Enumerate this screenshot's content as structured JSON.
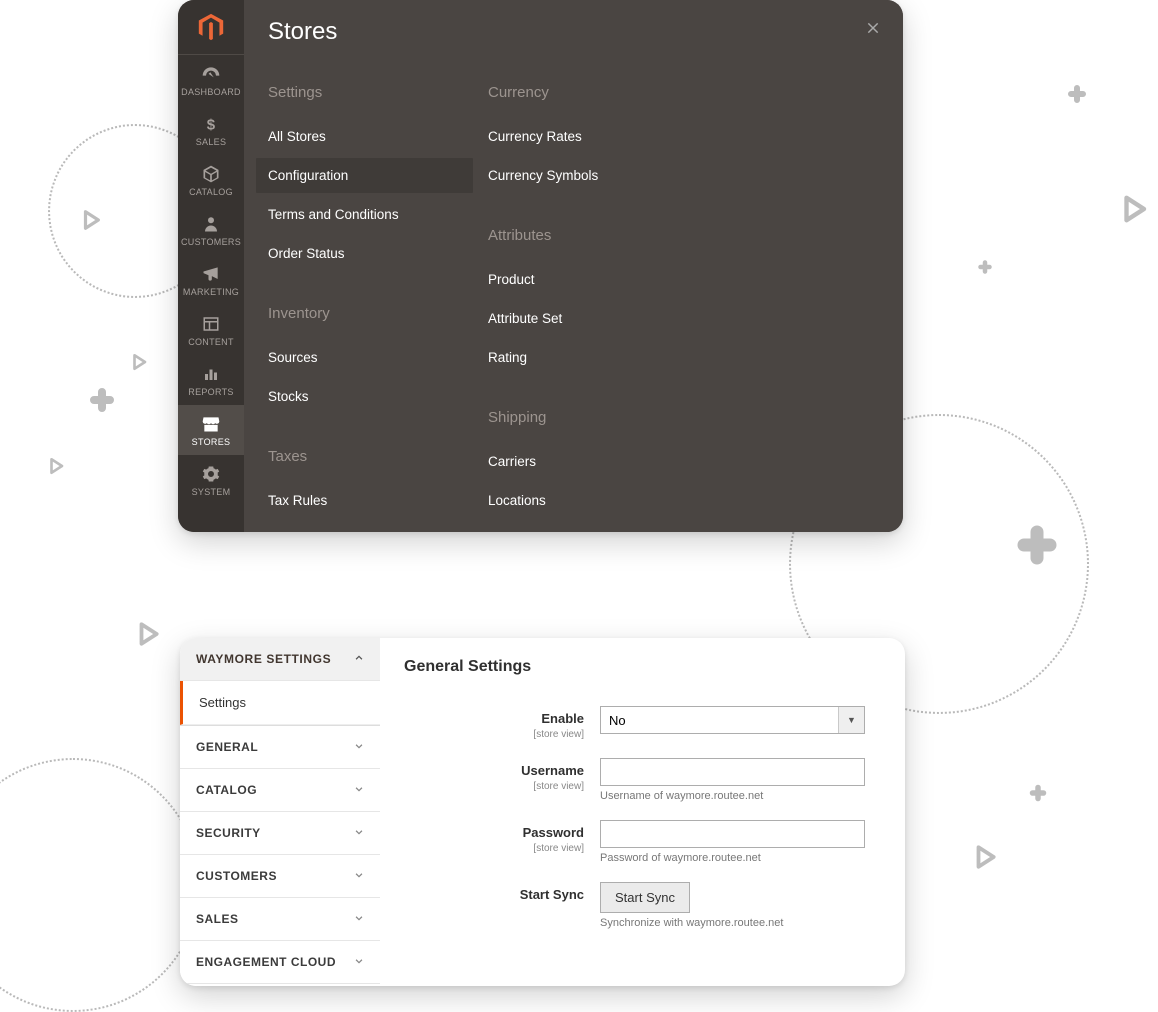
{
  "nav": {
    "items": [
      {
        "label": "DASHBOARD"
      },
      {
        "label": "SALES"
      },
      {
        "label": "CATALOG"
      },
      {
        "label": "CUSTOMERS"
      },
      {
        "label": "MARKETING"
      },
      {
        "label": "CONTENT"
      },
      {
        "label": "REPORTS"
      },
      {
        "label": "STORES"
      },
      {
        "label": "SYSTEM"
      }
    ]
  },
  "flyout": {
    "title": "Stores",
    "columns": [
      {
        "groups": [
          {
            "title": "Settings",
            "links": [
              "All Stores",
              "Configuration",
              "Terms and Conditions",
              "Order Status"
            ],
            "active_index": 1
          },
          {
            "title": "Inventory",
            "links": [
              "Sources",
              "Stocks"
            ]
          },
          {
            "title": "Taxes",
            "links": [
              "Tax Rules"
            ]
          }
        ]
      },
      {
        "groups": [
          {
            "title": "Currency",
            "links": [
              "Currency Rates",
              "Currency Symbols"
            ]
          },
          {
            "title": "Attributes",
            "links": [
              "Product",
              "Attribute Set",
              "Rating"
            ]
          },
          {
            "title": "Shipping",
            "links": [
              "Carriers",
              "Locations"
            ]
          }
        ]
      }
    ]
  },
  "config": {
    "sidebar": {
      "open_section": "WAYMORE  SETTINGS",
      "open_subitem": "Settings",
      "sections": [
        "GENERAL",
        "CATALOG",
        "SECURITY",
        "CUSTOMERS",
        "SALES",
        "ENGAGEMENT CLOUD"
      ]
    },
    "title": "General Settings",
    "scope_label": "[store view]",
    "fields": {
      "enable": {
        "label": "Enable",
        "value": "No"
      },
      "username": {
        "label": "Username",
        "value": "",
        "helper": "Username of waymore.routee.net"
      },
      "password": {
        "label": "Password",
        "value": "",
        "helper": "Password of waymore.routee.net"
      },
      "sync": {
        "label": "Start Sync",
        "button": "Start Sync",
        "helper": "Synchronize with waymore.routee.net"
      }
    }
  }
}
